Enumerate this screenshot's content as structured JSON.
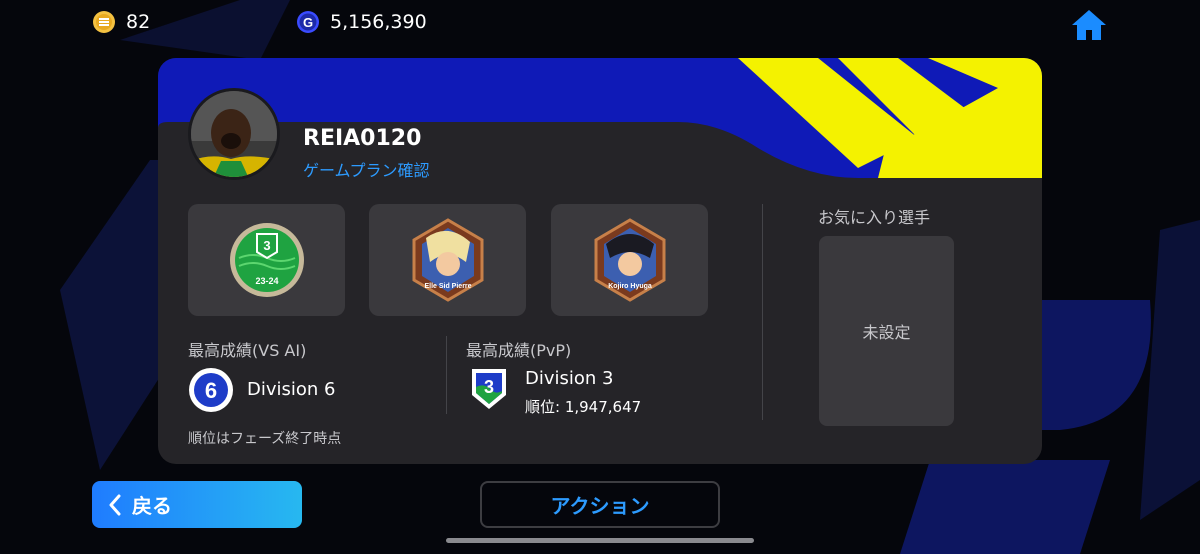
{
  "currencies": {
    "coins": {
      "icon": "e-coin-icon",
      "value": "82",
      "color": "#f4c141"
    },
    "gp": {
      "icon": "gp-icon",
      "value": "5,156,390",
      "color": "#3a4bff"
    }
  },
  "nav": {
    "home_icon": "home-icon",
    "home_color": "#1b8cff"
  },
  "profile": {
    "username": "REIA0120",
    "gameplan_link": "ゲームプラン確認",
    "header_colors": {
      "blue": "#0f1ab7",
      "yellow": "#f4f200"
    }
  },
  "badges": [
    {
      "name": "division-3-season-badge",
      "number": "3",
      "season": "23-24"
    },
    {
      "name": "pierre-character-badge",
      "text": "Elle Sid Pierre"
    },
    {
      "name": "hyuga-character-badge",
      "text": "Kojiro Hyuga"
    }
  ],
  "records": {
    "vs_ai": {
      "label": "最高成績(VS AI)",
      "icon_number": "6",
      "division": "Division 6"
    },
    "pvp": {
      "label": "最高成績(PvP)",
      "icon_number": "3",
      "division": "Division 3",
      "rank": "順位: 1,947,647"
    },
    "note": "順位はフェーズ終了時点"
  },
  "favorite": {
    "title": "お気に入り選手",
    "empty_text": "未設定"
  },
  "buttons": {
    "back": "戻る",
    "action": "アクション"
  }
}
